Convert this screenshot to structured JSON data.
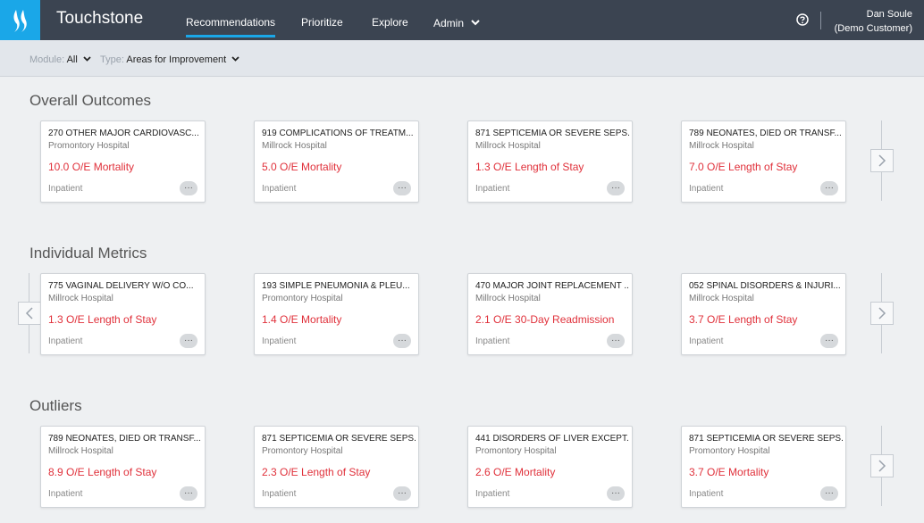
{
  "header": {
    "brand": "Touchstone",
    "nav": [
      {
        "label": "Recommendations"
      },
      {
        "label": "Prioritize"
      },
      {
        "label": "Explore"
      },
      {
        "label": "Admin"
      }
    ],
    "user": {
      "name": "Dan Soule",
      "org": "(Demo Customer)"
    }
  },
  "filters": {
    "module": {
      "label": "Module:",
      "value": "All"
    },
    "type": {
      "label": "Type:",
      "value": "Areas for Improvement"
    }
  },
  "sections": [
    {
      "title": "Overall Outcomes",
      "cards": [
        {
          "title": "270 OTHER MAJOR CARDIOVASC...",
          "hospital": "Promontory Hospital",
          "metric": "10.0 O/E Mortality",
          "type": "Inpatient"
        },
        {
          "title": "919 COMPLICATIONS OF TREATM...",
          "hospital": "Millrock Hospital",
          "metric": "5.0 O/E Mortality",
          "type": "Inpatient"
        },
        {
          "title": "871 SEPTICEMIA OR SEVERE SEPS...",
          "hospital": "Millrock Hospital",
          "metric": "1.3 O/E Length of Stay",
          "type": "Inpatient"
        },
        {
          "title": "789 NEONATES, DIED OR TRANSF...",
          "hospital": "Millrock Hospital",
          "metric": "7.0 O/E Length of Stay",
          "type": "Inpatient"
        }
      ]
    },
    {
      "title": "Individual Metrics",
      "cards": [
        {
          "title": "775 VAGINAL DELIVERY W/O CO...",
          "hospital": "Millrock Hospital",
          "metric": "1.3 O/E Length of Stay",
          "type": "Inpatient"
        },
        {
          "title": "193 SIMPLE PNEUMONIA & PLEU...",
          "hospital": "Promontory Hospital",
          "metric": "1.4 O/E Mortality",
          "type": "Inpatient"
        },
        {
          "title": "470 MAJOR JOINT REPLACEMENT ...",
          "hospital": "Millrock Hospital",
          "metric": "2.1 O/E 30-Day Readmission",
          "type": "Inpatient"
        },
        {
          "title": "052 SPINAL DISORDERS & INJURI...",
          "hospital": "Millrock Hospital",
          "metric": "3.7 O/E Length of Stay",
          "type": "Inpatient"
        }
      ]
    },
    {
      "title": "Outliers",
      "cards": [
        {
          "title": "789 NEONATES, DIED OR TRANSF...",
          "hospital": "Millrock Hospital",
          "metric": "8.9 O/E Length of Stay",
          "type": "Inpatient"
        },
        {
          "title": "871 SEPTICEMIA OR SEVERE SEPS...",
          "hospital": "Promontory Hospital",
          "metric": "2.3 O/E Length of Stay",
          "type": "Inpatient"
        },
        {
          "title": "441 DISORDERS OF LIVER EXCEPT...",
          "hospital": "Promontory Hospital",
          "metric": "2.6 O/E Mortality",
          "type": "Inpatient"
        },
        {
          "title": "871 SEPTICEMIA OR SEVERE SEPS...",
          "hospital": "Promontory Hospital",
          "metric": "3.7 O/E Mortality",
          "type": "Inpatient"
        }
      ]
    }
  ],
  "more_glyph": "···",
  "icons": {
    "logo": "flame-icon",
    "help": "question-circle-icon",
    "chevron": "chevron-down-icon",
    "next": "chevron-right-icon",
    "prev": "chevron-left-icon"
  },
  "colors": {
    "topbar": "#3b4451",
    "accent": "#1aa7e8",
    "metric": "#e0303a",
    "background": "#eef0f2"
  }
}
